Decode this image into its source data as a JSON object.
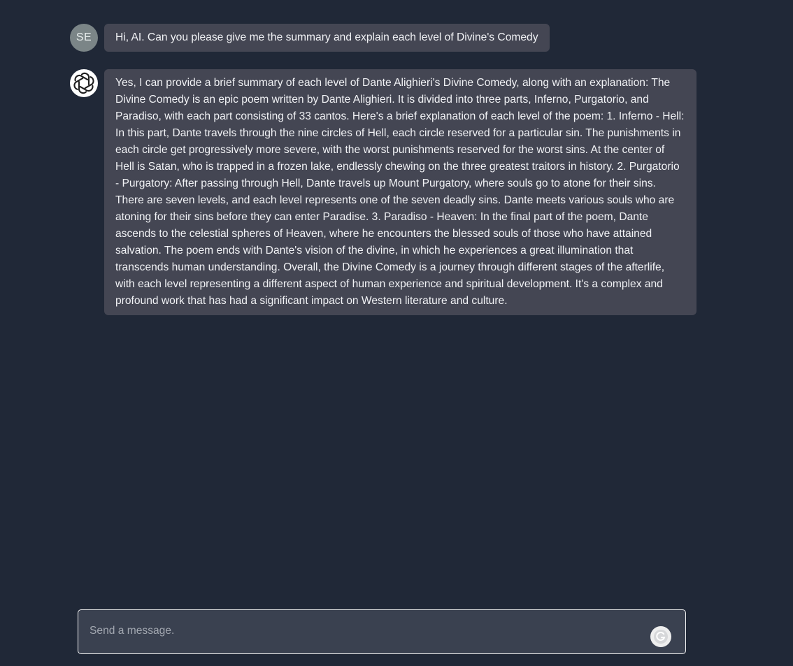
{
  "conversation": {
    "user_message": {
      "avatar_initials": "SE",
      "text": "Hi, AI. Can you please give me the summary and explain each level of Divine's Comedy"
    },
    "assistant_message": {
      "avatar_icon": "openai-logo-icon",
      "text": "Yes, I can provide a brief summary of each level of Dante Alighieri's Divine Comedy, along with an explanation: The Divine Comedy is an epic poem written by Dante Alighieri. It is divided into three parts, Inferno, Purgatorio, and Paradiso, with each part consisting of 33 cantos. Here's a brief explanation of each level of the poem: 1. Inferno - Hell: In this part, Dante travels through the nine circles of Hell, each circle reserved for a particular sin. The punishments in each circle get progressively more severe, with the worst punishments reserved for the worst sins. At the center of Hell is Satan, who is trapped in a frozen lake, endlessly chewing on the three greatest traitors in history. 2. Purgatorio - Purgatory: After passing through Hell, Dante travels up Mount Purgatory, where souls go to atone for their sins. There are seven levels, and each level represents one of the seven deadly sins. Dante meets various souls who are atoning for their sins before they can enter Paradise. 3. Paradiso - Heaven: In the final part of the poem, Dante ascends to the celestial spheres of Heaven, where he encounters the blessed souls of those who have attained salvation. The poem ends with Dante's vision of the divine, in which he experiences a great illumination that transcends human understanding. Overall, the Divine Comedy is a journey through different stages of the afterlife, with each level representing a different aspect of human experience and spiritual development. It's a complex and profound work that has had a significant impact on Western literature and culture."
    }
  },
  "composer": {
    "placeholder": "Send a message.",
    "value": "",
    "send_icon": "grammarly-g-icon"
  },
  "colors": {
    "background": "#202837",
    "bubble": "#444653",
    "user_avatar": "#7b8587",
    "composer": "#3a4150"
  }
}
